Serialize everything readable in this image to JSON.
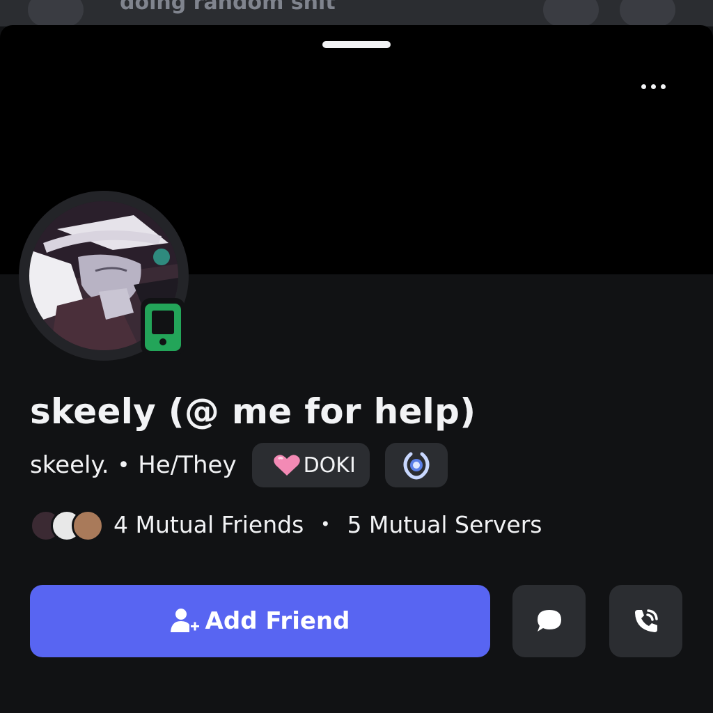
{
  "background_sheet": {
    "partial_title": "doing random shit"
  },
  "profile": {
    "display_name": "skeely (@ me for help)",
    "username": "skeely.",
    "separator": "•",
    "pronouns": "He/They",
    "clan_tag": "DOKI",
    "clan_icon": "pink-heart-icon",
    "badge_icon": "laurel-wreath-badge-icon",
    "status": "online-mobile"
  },
  "mutuals": {
    "friends_label": "4 Mutual Friends",
    "separator": "•",
    "servers_label": "5 Mutual Servers"
  },
  "actions": {
    "add_friend_label": "Add Friend",
    "message_icon": "chat-bubble-icon",
    "call_icon": "phone-call-icon"
  },
  "colors": {
    "accent": "#5865f2",
    "online": "#23a559",
    "surface": "#2b2d31",
    "background": "#111214",
    "banner": "#000000"
  }
}
